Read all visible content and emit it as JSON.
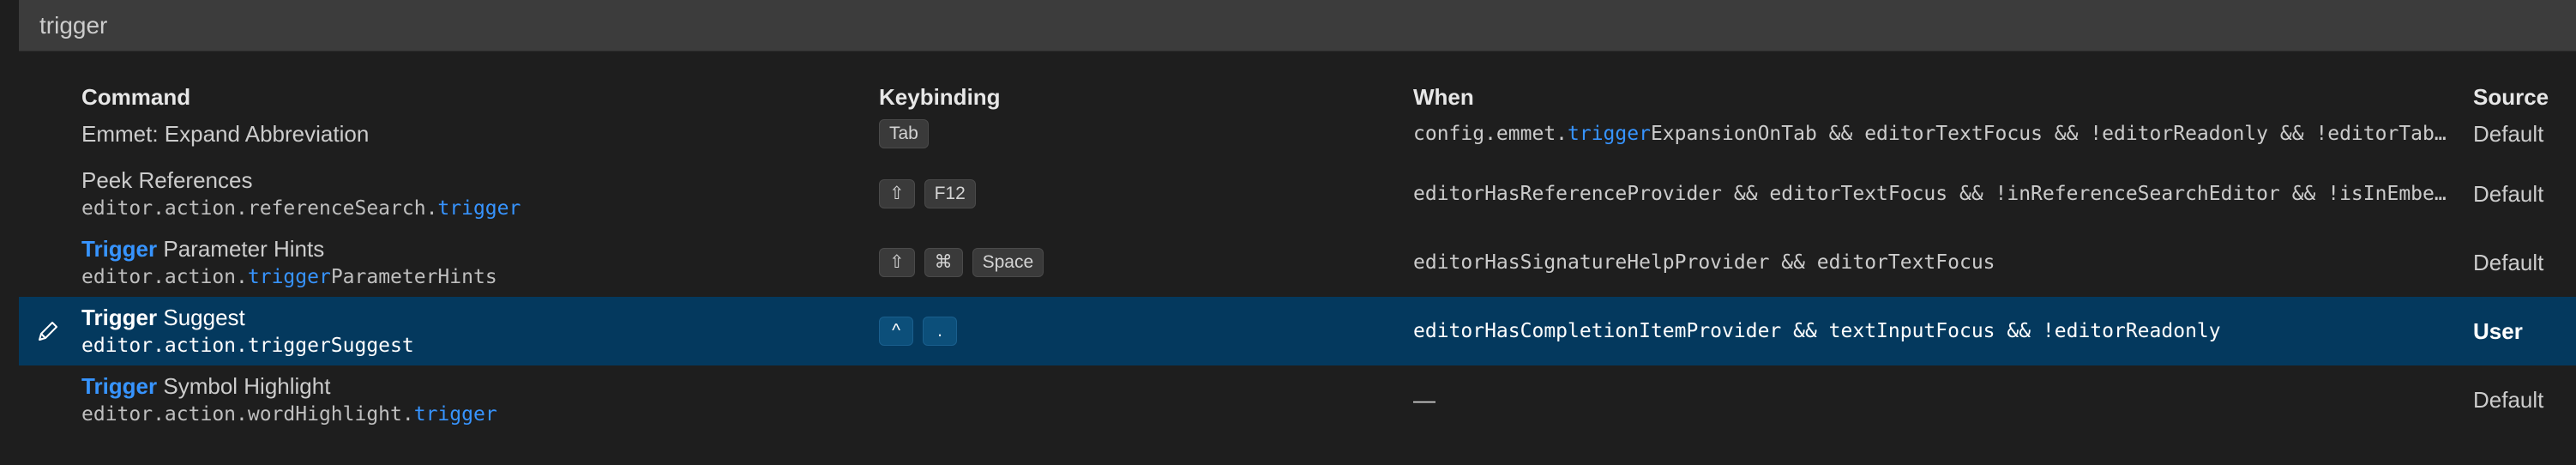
{
  "search": {
    "value": "trigger"
  },
  "headers": {
    "command": "Command",
    "keybinding": "Keybinding",
    "when": "When",
    "source": "Source"
  },
  "rows": [
    {
      "title_pre": "Emmet: Expand Abbreviation",
      "title_hl": "",
      "title_post": "",
      "id_pre": "",
      "id_hl": "",
      "id_post": "",
      "keys": [
        "Tab"
      ],
      "when_pre": "config.emmet.",
      "when_hl": "trigger",
      "when_post": "ExpansionOnTab && editorTextFocus && !editorReadonly && !editorTab…",
      "source": "Default"
    },
    {
      "title_pre": "Peek References",
      "title_hl": "",
      "title_post": "",
      "id_pre": "editor.action.referenceSearch.",
      "id_hl": "trigger",
      "id_post": "",
      "keys": [
        "⇧",
        "F12"
      ],
      "when_pre": "editorHasReferenceProvider && editorTextFocus && !inReferenceSearchEditor && !isInEmbe…",
      "when_hl": "",
      "when_post": "",
      "source": "Default"
    },
    {
      "title_pre": "",
      "title_hl": "Trigger",
      "title_post": " Parameter Hints",
      "id_pre": "editor.action.",
      "id_hl": "trigger",
      "id_post": "ParameterHints",
      "keys": [
        "⇧",
        "⌘",
        "Space"
      ],
      "when_pre": "editorHasSignatureHelpProvider && editorTextFocus",
      "when_hl": "",
      "when_post": "",
      "source": "Default"
    },
    {
      "title_pre": "",
      "title_hl": "Trigger",
      "title_post": " Suggest",
      "id_pre": "editor.action.triggerSuggest",
      "id_hl": "",
      "id_post": "",
      "keys": [
        "^",
        "."
      ],
      "when_pre": "editorHasCompletionItemProvider && textInputFocus && !editorReadonly",
      "when_hl": "",
      "when_post": "",
      "source": "User",
      "selected": true,
      "edit_icon": "pencil-icon"
    },
    {
      "title_pre": "",
      "title_hl": "Trigger",
      "title_post": " Symbol Highlight",
      "id_pre": "editor.action.wordHighlight.",
      "id_hl": "trigger",
      "id_post": "",
      "keys": [],
      "when_pre": "—",
      "when_hl": "",
      "when_post": "",
      "source": "Default"
    }
  ],
  "colors": {
    "background": "#1e1e1e",
    "search_background": "#3c3c3c",
    "selected_row": "#04395e",
    "highlight": "#3794ff"
  }
}
